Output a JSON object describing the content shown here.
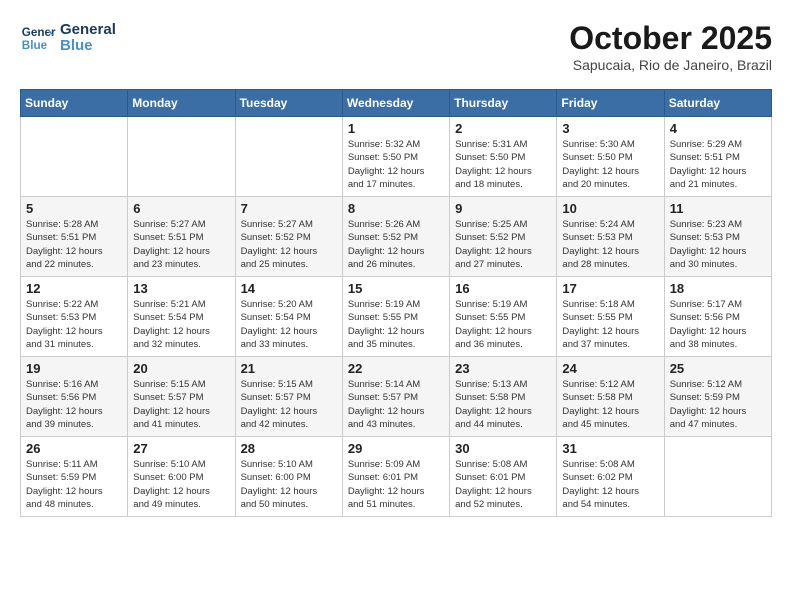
{
  "header": {
    "logo_general": "General",
    "logo_blue": "Blue",
    "month_title": "October 2025",
    "location": "Sapucaia, Rio de Janeiro, Brazil"
  },
  "weekdays": [
    "Sunday",
    "Monday",
    "Tuesday",
    "Wednesday",
    "Thursday",
    "Friday",
    "Saturday"
  ],
  "weeks": [
    [
      {
        "day": "",
        "info": ""
      },
      {
        "day": "",
        "info": ""
      },
      {
        "day": "",
        "info": ""
      },
      {
        "day": "1",
        "info": "Sunrise: 5:32 AM\nSunset: 5:50 PM\nDaylight: 12 hours\nand 17 minutes."
      },
      {
        "day": "2",
        "info": "Sunrise: 5:31 AM\nSunset: 5:50 PM\nDaylight: 12 hours\nand 18 minutes."
      },
      {
        "day": "3",
        "info": "Sunrise: 5:30 AM\nSunset: 5:50 PM\nDaylight: 12 hours\nand 20 minutes."
      },
      {
        "day": "4",
        "info": "Sunrise: 5:29 AM\nSunset: 5:51 PM\nDaylight: 12 hours\nand 21 minutes."
      }
    ],
    [
      {
        "day": "5",
        "info": "Sunrise: 5:28 AM\nSunset: 5:51 PM\nDaylight: 12 hours\nand 22 minutes."
      },
      {
        "day": "6",
        "info": "Sunrise: 5:27 AM\nSunset: 5:51 PM\nDaylight: 12 hours\nand 23 minutes."
      },
      {
        "day": "7",
        "info": "Sunrise: 5:27 AM\nSunset: 5:52 PM\nDaylight: 12 hours\nand 25 minutes."
      },
      {
        "day": "8",
        "info": "Sunrise: 5:26 AM\nSunset: 5:52 PM\nDaylight: 12 hours\nand 26 minutes."
      },
      {
        "day": "9",
        "info": "Sunrise: 5:25 AM\nSunset: 5:52 PM\nDaylight: 12 hours\nand 27 minutes."
      },
      {
        "day": "10",
        "info": "Sunrise: 5:24 AM\nSunset: 5:53 PM\nDaylight: 12 hours\nand 28 minutes."
      },
      {
        "day": "11",
        "info": "Sunrise: 5:23 AM\nSunset: 5:53 PM\nDaylight: 12 hours\nand 30 minutes."
      }
    ],
    [
      {
        "day": "12",
        "info": "Sunrise: 5:22 AM\nSunset: 5:53 PM\nDaylight: 12 hours\nand 31 minutes."
      },
      {
        "day": "13",
        "info": "Sunrise: 5:21 AM\nSunset: 5:54 PM\nDaylight: 12 hours\nand 32 minutes."
      },
      {
        "day": "14",
        "info": "Sunrise: 5:20 AM\nSunset: 5:54 PM\nDaylight: 12 hours\nand 33 minutes."
      },
      {
        "day": "15",
        "info": "Sunrise: 5:19 AM\nSunset: 5:55 PM\nDaylight: 12 hours\nand 35 minutes."
      },
      {
        "day": "16",
        "info": "Sunrise: 5:19 AM\nSunset: 5:55 PM\nDaylight: 12 hours\nand 36 minutes."
      },
      {
        "day": "17",
        "info": "Sunrise: 5:18 AM\nSunset: 5:55 PM\nDaylight: 12 hours\nand 37 minutes."
      },
      {
        "day": "18",
        "info": "Sunrise: 5:17 AM\nSunset: 5:56 PM\nDaylight: 12 hours\nand 38 minutes."
      }
    ],
    [
      {
        "day": "19",
        "info": "Sunrise: 5:16 AM\nSunset: 5:56 PM\nDaylight: 12 hours\nand 39 minutes."
      },
      {
        "day": "20",
        "info": "Sunrise: 5:15 AM\nSunset: 5:57 PM\nDaylight: 12 hours\nand 41 minutes."
      },
      {
        "day": "21",
        "info": "Sunrise: 5:15 AM\nSunset: 5:57 PM\nDaylight: 12 hours\nand 42 minutes."
      },
      {
        "day": "22",
        "info": "Sunrise: 5:14 AM\nSunset: 5:57 PM\nDaylight: 12 hours\nand 43 minutes."
      },
      {
        "day": "23",
        "info": "Sunrise: 5:13 AM\nSunset: 5:58 PM\nDaylight: 12 hours\nand 44 minutes."
      },
      {
        "day": "24",
        "info": "Sunrise: 5:12 AM\nSunset: 5:58 PM\nDaylight: 12 hours\nand 45 minutes."
      },
      {
        "day": "25",
        "info": "Sunrise: 5:12 AM\nSunset: 5:59 PM\nDaylight: 12 hours\nand 47 minutes."
      }
    ],
    [
      {
        "day": "26",
        "info": "Sunrise: 5:11 AM\nSunset: 5:59 PM\nDaylight: 12 hours\nand 48 minutes."
      },
      {
        "day": "27",
        "info": "Sunrise: 5:10 AM\nSunset: 6:00 PM\nDaylight: 12 hours\nand 49 minutes."
      },
      {
        "day": "28",
        "info": "Sunrise: 5:10 AM\nSunset: 6:00 PM\nDaylight: 12 hours\nand 50 minutes."
      },
      {
        "day": "29",
        "info": "Sunrise: 5:09 AM\nSunset: 6:01 PM\nDaylight: 12 hours\nand 51 minutes."
      },
      {
        "day": "30",
        "info": "Sunrise: 5:08 AM\nSunset: 6:01 PM\nDaylight: 12 hours\nand 52 minutes."
      },
      {
        "day": "31",
        "info": "Sunrise: 5:08 AM\nSunset: 6:02 PM\nDaylight: 12 hours\nand 54 minutes."
      },
      {
        "day": "",
        "info": ""
      }
    ]
  ]
}
